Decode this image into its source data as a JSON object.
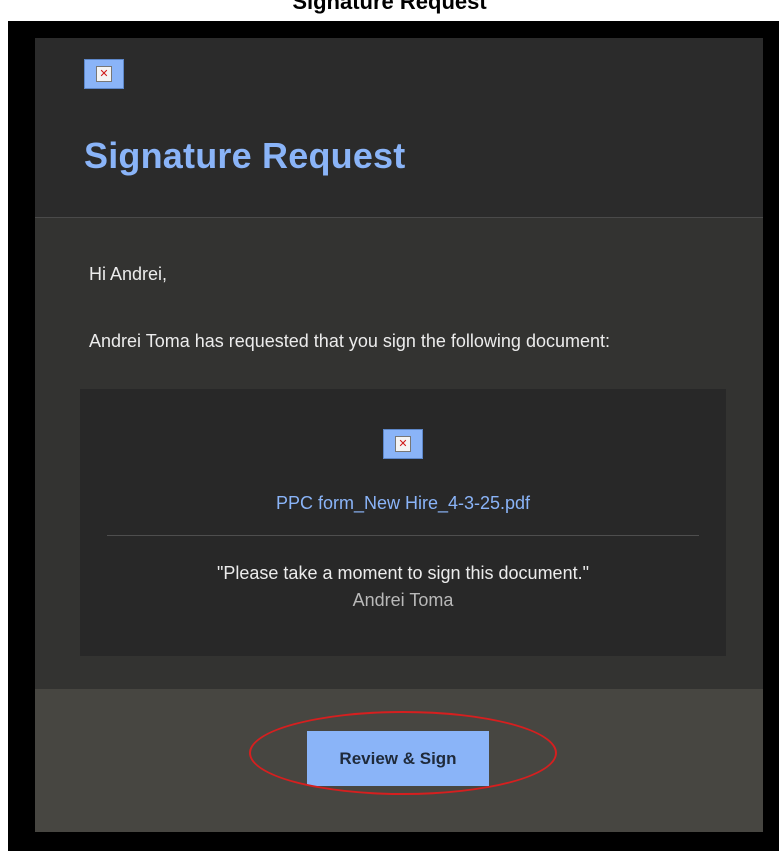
{
  "page": {
    "top_title": "Signature Request"
  },
  "header": {
    "logo_icon": "broken-image-icon",
    "title": "Signature Request"
  },
  "body": {
    "greeting": "Hi Andrei,",
    "intro": "Andrei Toma has requested that you sign the following document:"
  },
  "document": {
    "icon": "broken-image-icon",
    "file_name": "PPC form_New Hire_4-3-25.pdf",
    "message": "\"Please take a moment to sign this document.\"",
    "sender": "Andrei Toma"
  },
  "footer": {
    "button_label": "Review & Sign"
  },
  "colors": {
    "accent": "#8ab4f8",
    "header_bg": "#2b2b2b",
    "body_bg": "#333331",
    "footer_bg": "#474641",
    "highlight": "#d61f1f"
  }
}
